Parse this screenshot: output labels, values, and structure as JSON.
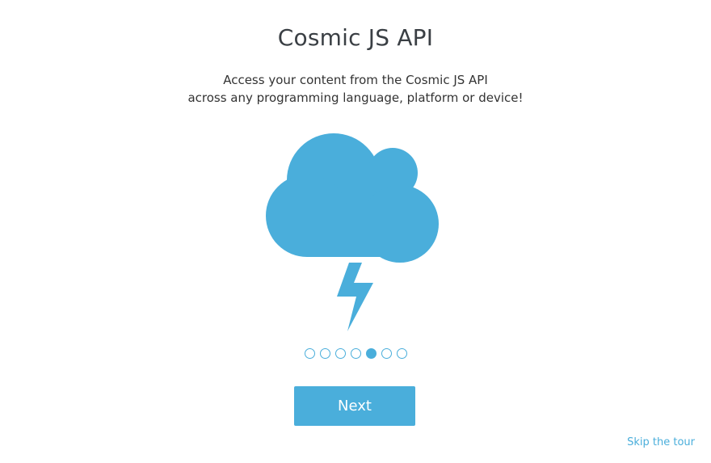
{
  "tour": {
    "title": "Cosmic JS API",
    "subtitle_line1": "Access your content from the Cosmic JS API",
    "subtitle_line2": "across any programming language, platform or device!",
    "illustration_icon": "cloud-lightning-icon",
    "accent_color": "#4aaedb",
    "step_total": 7,
    "step_current": 5,
    "next_label": "Next",
    "skip_label": "Skip the tour"
  }
}
